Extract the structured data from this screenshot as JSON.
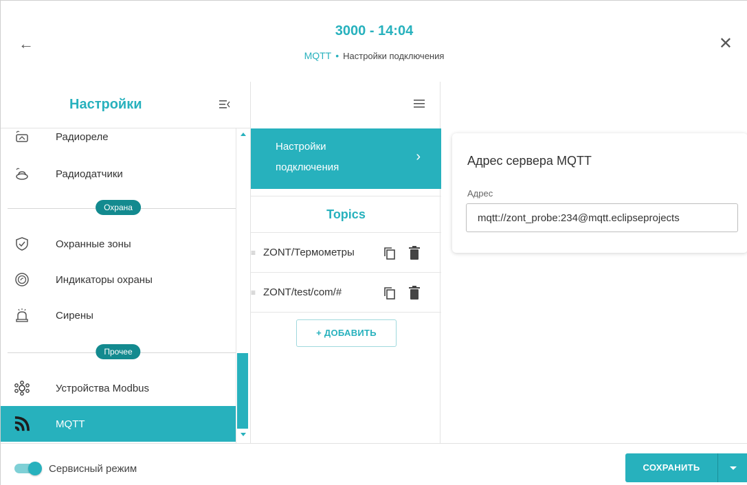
{
  "header": {
    "title": "3000 - 14:04",
    "crumb_root": "MQTT",
    "crumb_sep": "•",
    "crumb_current": "Настройки подключения"
  },
  "sidebar": {
    "title": "Настройки",
    "items": [
      {
        "label": "Радиореле",
        "icon": "radio-relay-icon"
      },
      {
        "label": "Радиодатчики",
        "icon": "radio-sensor-icon"
      },
      {
        "section": "Охрана"
      },
      {
        "label": "Охранные зоны",
        "icon": "shield-check-icon"
      },
      {
        "label": "Индикаторы охраны",
        "icon": "security-indicator-icon"
      },
      {
        "label": "Сирены",
        "icon": "siren-icon"
      },
      {
        "section": "Прочее"
      },
      {
        "label": "Устройства Modbus",
        "icon": "modbus-icon"
      },
      {
        "label": "MQTT",
        "icon": "mqtt-icon",
        "active": true
      }
    ]
  },
  "middle": {
    "selected_line1": "Настройки",
    "selected_line2": "подключения",
    "topics_title": "Topics",
    "topics": [
      {
        "name": "ZONT/Термометры"
      },
      {
        "name": "ZONT/test/com/#"
      }
    ],
    "add_label": "+  ДОБАВИТЬ"
  },
  "card": {
    "title": "Адрес сервера MQTT",
    "field_label": "Адрес",
    "field_value": "mqtt://zont_probe:234@mqtt.eclipseprojects"
  },
  "footer": {
    "service_mode_label": "Сервисный режим",
    "service_mode_on": true,
    "save_label": "СОХРАНИТЬ"
  },
  "colors": {
    "accent": "#27b1bd",
    "section_pill": "#138a8f"
  }
}
